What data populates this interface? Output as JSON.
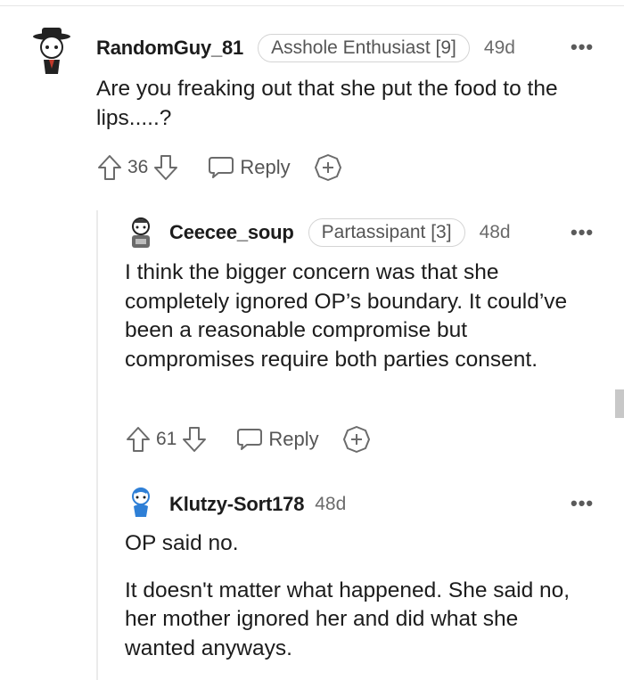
{
  "comments": [
    {
      "username": "RandomGuy_81",
      "flair": "Asshole Enthusiast [9]",
      "age": "49d",
      "more": "•••",
      "body": [
        "Are you freaking out that she put the food to the lips.....?"
      ],
      "votes": "36",
      "reply_label": "Reply"
    },
    {
      "username": "Ceecee_soup",
      "flair": "Partassipant [3]",
      "age": "48d",
      "more": "•••",
      "body": [
        "I think the bigger concern was that she completely ignored OP’s boundary. It could’ve been a reasonable compromise but compromises require both parties consent."
      ],
      "votes": "61",
      "reply_label": "Reply"
    },
    {
      "username": "Klutzy-Sort178",
      "age": "48d",
      "more": "•••",
      "body": [
        "OP said no.",
        "It doesn't matter what happened. She said no, her mother ignored her and did what she wanted anyways."
      ]
    }
  ],
  "icons": {
    "upvote": "arrow-up-icon",
    "downvote": "arrow-down-icon",
    "reply": "speech-bubble-icon",
    "award": "award-plus-icon",
    "more": "more-options-icon"
  },
  "colors": {
    "text": "#1c1c1c",
    "meta": "#6b6b6b",
    "flair_border": "#d4d4d4",
    "thread_line": "#ebebeb"
  }
}
